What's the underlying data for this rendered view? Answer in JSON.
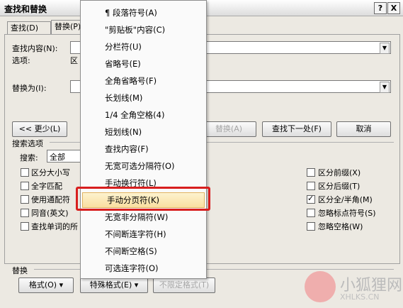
{
  "window": {
    "title": "查找和替换",
    "help_btn": "?",
    "close_btn": "X"
  },
  "tabs": [
    {
      "label": "查找(D)"
    },
    {
      "label": "替换(P)"
    }
  ],
  "find": {
    "label": "查找内容(N):",
    "options_label": "选项:",
    "options_value": "区"
  },
  "replace": {
    "label": "替换为(I):"
  },
  "buttons": {
    "less": "<< 更少(L)",
    "replace_partial": "替换(A)",
    "find_next": "查找下一处(F)",
    "cancel": "取消",
    "format": "格式(O) ▾",
    "special": "特殊格式(E) ▾",
    "no_format": "不限定格式(T)"
  },
  "search_options": {
    "title": "搜索选项",
    "search_label": "搜索:",
    "search_value": "全部"
  },
  "left_checks": [
    {
      "label": "区分大小写",
      "checked": false
    },
    {
      "label": "全字匹配",
      "checked": false
    },
    {
      "label": "使用通配符",
      "checked": false
    },
    {
      "label": "同音(英文)",
      "checked": false
    },
    {
      "label": "查找单词的所",
      "checked": false
    }
  ],
  "right_checks": [
    {
      "label": "区分前缀(X)",
      "checked": false
    },
    {
      "label": "区分后缀(T)",
      "checked": false
    },
    {
      "label": "区分全/半角(M)",
      "checked": true
    },
    {
      "label": "忽略标点符号(S)",
      "checked": false
    },
    {
      "label": "忽略空格(W)",
      "checked": false
    }
  ],
  "replace_section": {
    "title": "替换"
  },
  "menu": {
    "items": [
      "¶ 段落符号(A)",
      "\"剪贴板\"内容(C)",
      "分栏符(U)",
      "省略号(E)",
      "全角省略号(F)",
      "长划线(M)",
      "1/4 全角空格(4)",
      "短划线(N)",
      "查找内容(F)",
      "无宽可选分隔符(O)",
      "手动换行符(L)",
      "手动分页符(K)",
      "无宽非分隔符(W)",
      "不间断连字符(H)",
      "不间断空格(S)",
      "可选连字符(O)"
    ],
    "highlighted_index": 11
  },
  "watermark": {
    "cn": "小狐狸网",
    "en": "XHLKS.CN"
  }
}
